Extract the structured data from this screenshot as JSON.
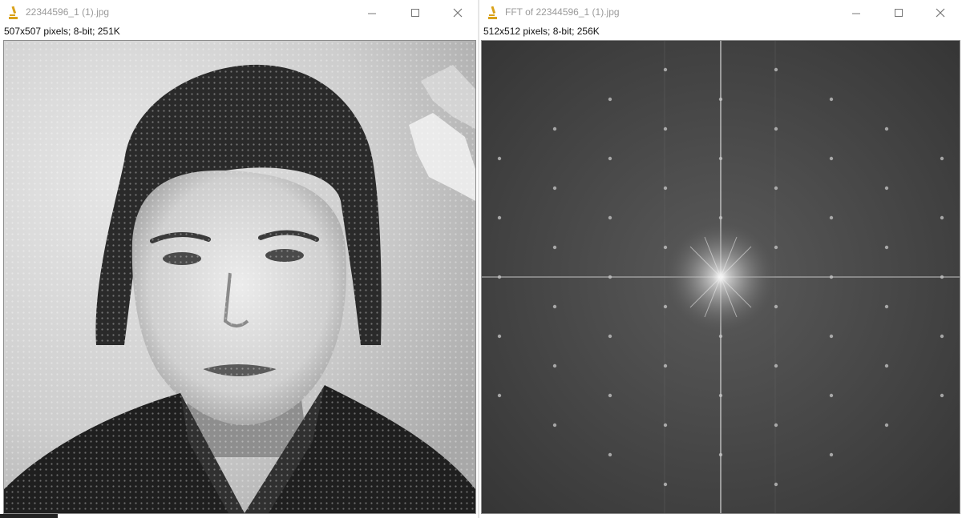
{
  "windows": {
    "left": {
      "title": "22344596_1 (1).jpg",
      "info": "507x507 pixels; 8-bit; 251K",
      "image": {
        "icon": "grayscale-portrait-photo"
      }
    },
    "right": {
      "title": "FFT of 22344596_1 (1).jpg",
      "info": "512x512 pixels; 8-bit; 256K",
      "image": {
        "icon": "fft-power-spectrum"
      }
    }
  },
  "icons": {
    "app": "imagej-microscope-icon",
    "minimize": "minimize-icon",
    "maximize": "maximize-icon",
    "close": "close-icon"
  },
  "colors": {
    "title_text": "#9a9a9a",
    "app_icon": "#d9a21b",
    "spectrum_background": "#3a3a3a"
  }
}
